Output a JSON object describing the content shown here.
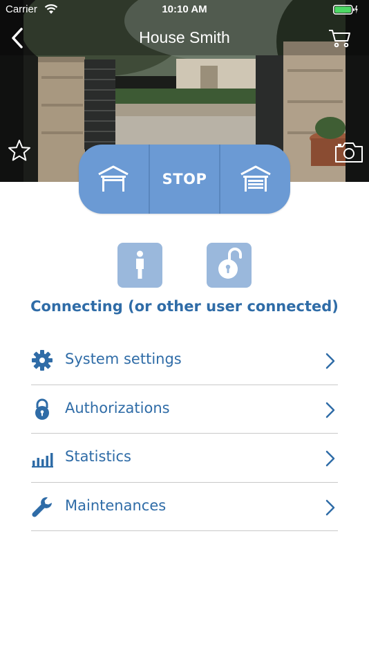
{
  "status_bar": {
    "carrier": "Carrier",
    "time": "10:10 AM"
  },
  "nav": {
    "title": "House Smith",
    "back_icon": "chevron-left-icon",
    "cart_icon": "cart-icon"
  },
  "hero": {
    "favorite_icon": "star-outline-icon",
    "camera_icon": "camera-icon"
  },
  "gate_control": {
    "open_icon": "garage-open-icon",
    "stop_label": "STOP",
    "close_icon": "garage-closed-icon",
    "color": "#6b9ad4"
  },
  "quick_actions": [
    {
      "icon": "user-icon"
    },
    {
      "icon": "unlock-icon"
    }
  ],
  "connection_status": "Connecting (or other user connected)",
  "menu": {
    "items": [
      {
        "label": "System settings",
        "icon": "gear-icon"
      },
      {
        "label": "Authorizations",
        "icon": "lock-icon"
      },
      {
        "label": "Statistics",
        "icon": "bar-chart-icon"
      },
      {
        "label": "Maintenances",
        "icon": "wrench-icon"
      }
    ]
  },
  "colors": {
    "accent_text": "#2f6ca7",
    "button_blue": "#6b9ad4",
    "button_light": "#9ab8dc",
    "divider": "#c8c8c8"
  }
}
